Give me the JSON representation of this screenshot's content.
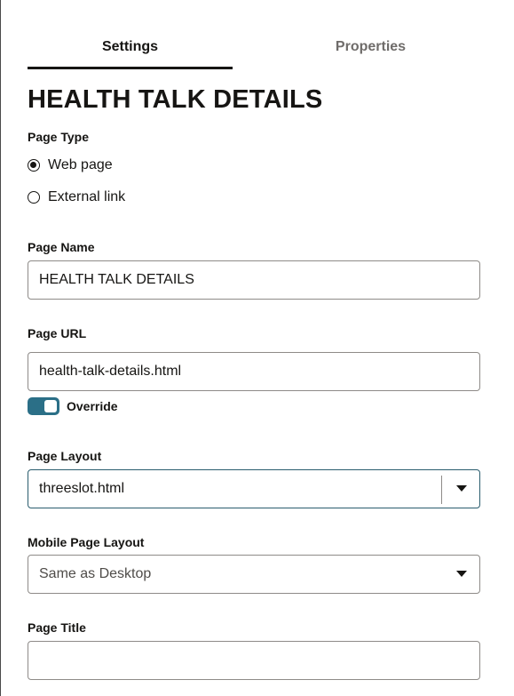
{
  "tabs": [
    {
      "label": "Settings",
      "active": true
    },
    {
      "label": "Properties",
      "active": false
    }
  ],
  "heading": "HEALTH TALK DETAILS",
  "page_type": {
    "label": "Page Type",
    "options": [
      {
        "label": "Web page",
        "checked": true
      },
      {
        "label": "External link",
        "checked": false
      }
    ]
  },
  "page_name": {
    "label": "Page Name",
    "value": "HEALTH TALK DETAILS"
  },
  "page_url": {
    "label": "Page URL",
    "value": "health-talk-details.html",
    "override_label": "Override",
    "override_on": true
  },
  "page_layout": {
    "label": "Page Layout",
    "value": "threeslot.html"
  },
  "mobile_layout": {
    "label": "Mobile Page Layout",
    "value": "Same as Desktop"
  },
  "page_title": {
    "label": "Page Title",
    "value": ""
  },
  "colors": {
    "accent": "#2b6f87",
    "text": "#161513",
    "muted": "#6f6c6a",
    "border": "#8e8b88"
  }
}
